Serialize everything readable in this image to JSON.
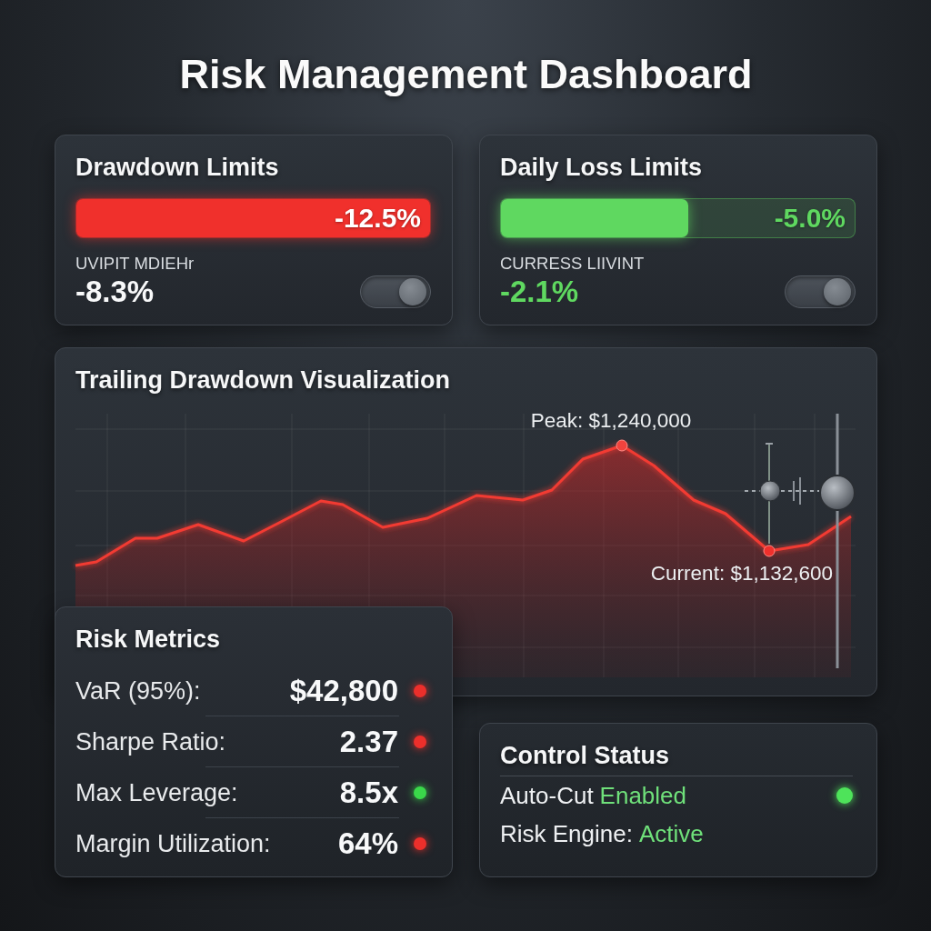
{
  "title": "Risk Management Dashboard",
  "limits": [
    {
      "title": "Drawdown Limits",
      "color": "#f0302c",
      "level": 1,
      "reading": "-12.5%",
      "current_label": "UVIPIT MDIEHr",
      "current_value": "-8.3%",
      "current_highlight": false,
      "toggle_on": true
    },
    {
      "title": "Daily Loss Limits",
      "color": "#5fd860",
      "level": 0.53,
      "reading": "-5.0%",
      "current_label": "CURRESS LIIVINT",
      "current_value": "-2.1%",
      "current_highlight": true,
      "toggle_on": true
    }
  ],
  "chart": {
    "title": "Trailing Drawdown Visualization",
    "peak_label": "Peak: $1,240,000",
    "current_label": "Current: $1,132,600"
  },
  "metrics": {
    "title": "Risk Metrics",
    "items": [
      {
        "label": "VaR (95%):",
        "value": "$42,800",
        "color": "#ec2f2b"
      },
      {
        "label": "Sharpe Ratio:",
        "value": "2.37",
        "color": "#ec2f2b"
      },
      {
        "label": "Max Leverage:",
        "value": "8.5x",
        "color": "#3ad84a"
      },
      {
        "label": "Margin Utilization:",
        "value": "64%",
        "color": "#ec2f2b"
      }
    ]
  },
  "control_status": {
    "title": "Control Status",
    "items": [
      {
        "label": "Auto-Cut",
        "value": "Enabled",
        "indicator": true
      },
      {
        "label": "Risk Engine:",
        "value": "Active",
        "indicator": false
      }
    ]
  }
}
